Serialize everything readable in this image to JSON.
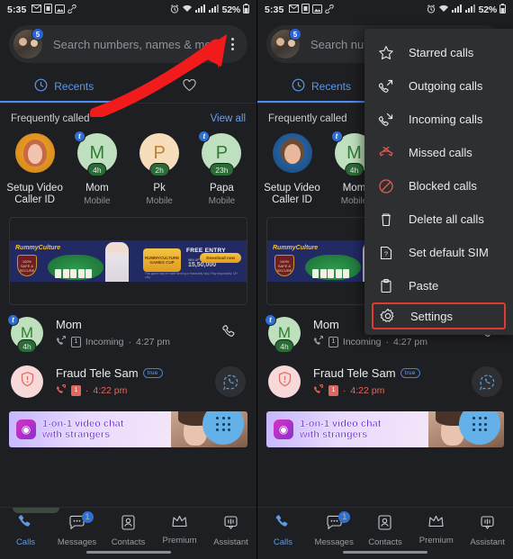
{
  "status_bar": {
    "time": "5:35",
    "battery": "52%",
    "left_icons": [
      "gmail-icon",
      "sim-icon",
      "photos-icon",
      "link-icon"
    ],
    "right_icons": [
      "alarm-icon",
      "wifi-icon",
      "signal-icon",
      "signal2-icon",
      "battery-icon"
    ]
  },
  "search": {
    "placeholder_full": "Search numbers, names & more",
    "placeholder_short": "Search num",
    "avatar_badge": "5"
  },
  "tabs": [
    {
      "label": "Recents",
      "icon": "history-icon",
      "active": true
    },
    {
      "label": "",
      "icon": "heart-icon",
      "active": false
    }
  ],
  "frequently_called": {
    "title": "Frequently called",
    "view_all": "View all",
    "items": [
      {
        "name": "Setup Video\nCaller ID",
        "name_line1": "Setup Video",
        "name_line2": "Caller ID",
        "subtitle": "",
        "initial": "",
        "duration": "",
        "truecaller_badge": false
      },
      {
        "name": "Mom",
        "name_line1": "Mom",
        "name_line2": "",
        "subtitle": "Mobile",
        "initial": "M",
        "duration": "4h",
        "truecaller_badge": true
      },
      {
        "name": "Pk",
        "name_line1": "Pk",
        "name_line2": "",
        "subtitle": "Mobile",
        "initial": "P",
        "duration": "2h",
        "truecaller_badge": false
      },
      {
        "name": "Papa",
        "name_line1": "Papa",
        "name_line2": "",
        "subtitle": "Mobile",
        "initial": "P",
        "duration": "23h",
        "truecaller_badge": true
      }
    ]
  },
  "ad_banner": {
    "brand": "RummyCulture",
    "shield_text": "100% SAFE & SECURE",
    "ribbon_text": "RUMMYCULTURE GAMES CUP",
    "free_entry": "FREE ENTRY",
    "prize_label": "WIN UPTO",
    "prize_amount": "15,50,000",
    "cta": "Download now",
    "disclaimer": "This game may be habit forming or financially risky. Play responsibly. 18+ only."
  },
  "calls": [
    {
      "name": "Mom",
      "verified": false,
      "verified_label": "",
      "call_type": "Incoming",
      "time": "4:27 pm",
      "sim": "1",
      "initial": "M",
      "duration": "4h",
      "truecaller_badge": true,
      "avatar_kind": "green-initial",
      "action": "phone-icon",
      "missed": false
    },
    {
      "name": "Fraud Tele Sam",
      "verified": true,
      "verified_label": "true",
      "call_type": "",
      "time": "4:22 pm",
      "sim": "1",
      "initial": "",
      "duration": "",
      "truecaller_badge": false,
      "avatar_kind": "spam-shield",
      "action": "whatsapp-icon",
      "missed": true
    }
  ],
  "video_ad": {
    "line1": "1-on-1 video chat",
    "line2": "with strangers",
    "icon": "camera-icon"
  },
  "dialpad_fab": {
    "icon": "dialpad-icon"
  },
  "bottom_nav": [
    {
      "label": "Calls",
      "icon": "phone-icon",
      "active": true,
      "badge": ""
    },
    {
      "label": "Messages",
      "icon": "chat-icon",
      "active": false,
      "badge": "1"
    },
    {
      "label": "Contacts",
      "icon": "contact-card-icon",
      "active": false,
      "badge": ""
    },
    {
      "label": "Premium",
      "icon": "crown-icon",
      "active": false,
      "badge": ""
    },
    {
      "label": "Assistant",
      "icon": "assistant-icon",
      "active": false,
      "badge": ""
    }
  ],
  "menu": {
    "items": [
      {
        "label": "Starred calls",
        "icon": "star-icon",
        "selected": false,
        "color": "#e8eaec"
      },
      {
        "label": "Outgoing calls",
        "icon": "outgoing-call-icon",
        "selected": false,
        "color": "#e8eaec"
      },
      {
        "label": "Incoming calls",
        "icon": "incoming-call-icon",
        "selected": false,
        "color": "#e8eaec"
      },
      {
        "label": "Missed calls",
        "icon": "missed-call-icon",
        "selected": false,
        "color": "#e35c52"
      },
      {
        "label": "Blocked calls",
        "icon": "blocked-icon",
        "selected": false,
        "color": "#e35c52"
      },
      {
        "label": "Delete all calls",
        "icon": "trash-icon",
        "selected": false,
        "color": "#e8eaec"
      },
      {
        "label": "Set default SIM",
        "icon": "sim-card-icon",
        "selected": false,
        "color": "#e8eaec"
      },
      {
        "label": "Paste",
        "icon": "clipboard-icon",
        "selected": false,
        "color": "#e8eaec"
      },
      {
        "label": "Settings",
        "icon": "gear-icon",
        "selected": true,
        "color": "#e8eaec"
      }
    ]
  },
  "colors": {
    "background": "#1e1f22",
    "menu_background": "#2d2f31",
    "accent_blue": "#4c8df0",
    "highlight_red": "#e03b32",
    "arrow_red": "#f21b1b",
    "missed_red": "#e35c52"
  }
}
